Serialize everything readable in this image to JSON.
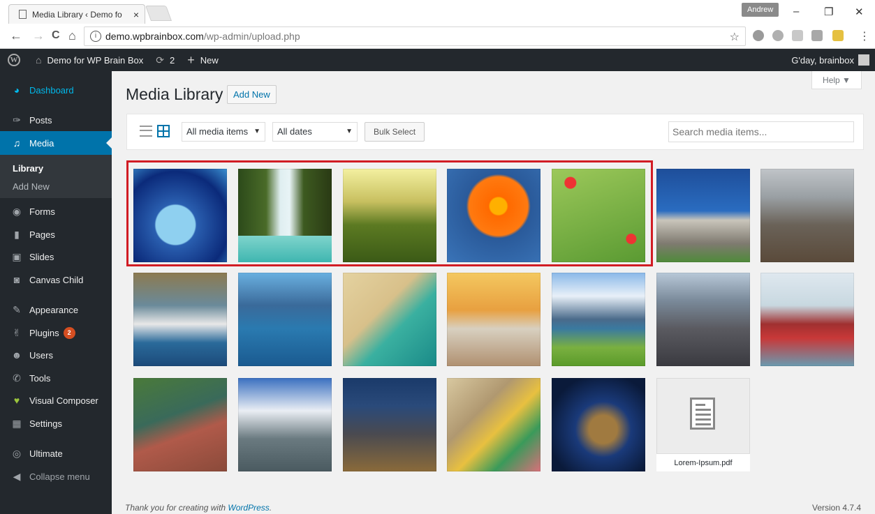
{
  "browser": {
    "tab_title": "Media Library ‹ Demo fo",
    "tab_close": "×",
    "window_user": "Andrew",
    "min": "–",
    "max": "❐",
    "close": "✕",
    "back": "←",
    "forward": "→",
    "reload": "C",
    "home": "⌂",
    "url_host": "demo.wpbrainbox.com",
    "url_path": "/wp-admin/upload.php",
    "star": "☆",
    "menu": "⋮"
  },
  "adminbar": {
    "logo": "W",
    "site_name": "Demo for WP Brain Box",
    "updates_count": "2",
    "new_label": "New",
    "greeting": "G'day, brainbox"
  },
  "sidebar": {
    "items": [
      {
        "label": "Dashboard",
        "icon": "dashboard-icon",
        "glyph": "◕"
      },
      {
        "label": "Posts",
        "icon": "pin-icon",
        "glyph": "✑"
      },
      {
        "label": "Media",
        "icon": "media-icon",
        "glyph": "♫"
      },
      {
        "label": "Forms",
        "icon": "forms-icon",
        "glyph": "◉"
      },
      {
        "label": "Pages",
        "icon": "pages-icon",
        "glyph": "▮"
      },
      {
        "label": "Slides",
        "icon": "slides-icon",
        "glyph": "▣"
      },
      {
        "label": "Canvas Child",
        "icon": "canvas-icon",
        "glyph": "◙"
      },
      {
        "label": "Appearance",
        "icon": "appearance-icon",
        "glyph": "✎"
      },
      {
        "label": "Plugins",
        "icon": "plugins-icon",
        "glyph": "✌",
        "badge": "2"
      },
      {
        "label": "Users",
        "icon": "users-icon",
        "glyph": "☻"
      },
      {
        "label": "Tools",
        "icon": "tools-icon",
        "glyph": "✆"
      },
      {
        "label": "Visual Composer",
        "icon": "composer-icon",
        "glyph": "♥"
      },
      {
        "label": "Settings",
        "icon": "settings-icon",
        "glyph": "▦"
      },
      {
        "label": "Ultimate",
        "icon": "ultimate-icon",
        "glyph": "◎"
      },
      {
        "label": "Collapse menu",
        "icon": "collapse-icon",
        "glyph": "◀"
      }
    ],
    "submenu": {
      "library": "Library",
      "add_new": "Add New"
    }
  },
  "main": {
    "help": "Help ▼",
    "title": "Media Library",
    "add_new": "Add New",
    "filter_type": "All media items",
    "filter_date": "All dates",
    "bulk_select": "Bulk Select",
    "search_placeholder": "Search media items...",
    "media": [
      {
        "name": "fishbowl"
      },
      {
        "name": "waterfall"
      },
      {
        "name": "sunlit-forest"
      },
      {
        "name": "orange-flower"
      },
      {
        "name": "red-poppies"
      },
      {
        "name": "modern-house"
      },
      {
        "name": "freight-train"
      },
      {
        "name": "cruise-ship"
      },
      {
        "name": "coastal-village"
      },
      {
        "name": "beach-aerial"
      },
      {
        "name": "elderly-couple"
      },
      {
        "name": "mountain-lake"
      },
      {
        "name": "city-traffic"
      },
      {
        "name": "cargo-ship"
      },
      {
        "name": "tennis-courts"
      },
      {
        "name": "harbour-bridge"
      },
      {
        "name": "city-night"
      },
      {
        "name": "money-coins"
      },
      {
        "name": "earth-night"
      },
      {
        "name": "pdf",
        "caption": "Lorem-Ipsum.pdf"
      }
    ]
  },
  "footer": {
    "thanks_prefix": "Thank you for creating with ",
    "thanks_link": "WordPress",
    "thanks_suffix": ".",
    "version": "Version 4.7.4"
  },
  "colors": {
    "admin_dark": "#23282d",
    "accent_blue": "#0073aa",
    "highlight_red": "#d11c24"
  }
}
